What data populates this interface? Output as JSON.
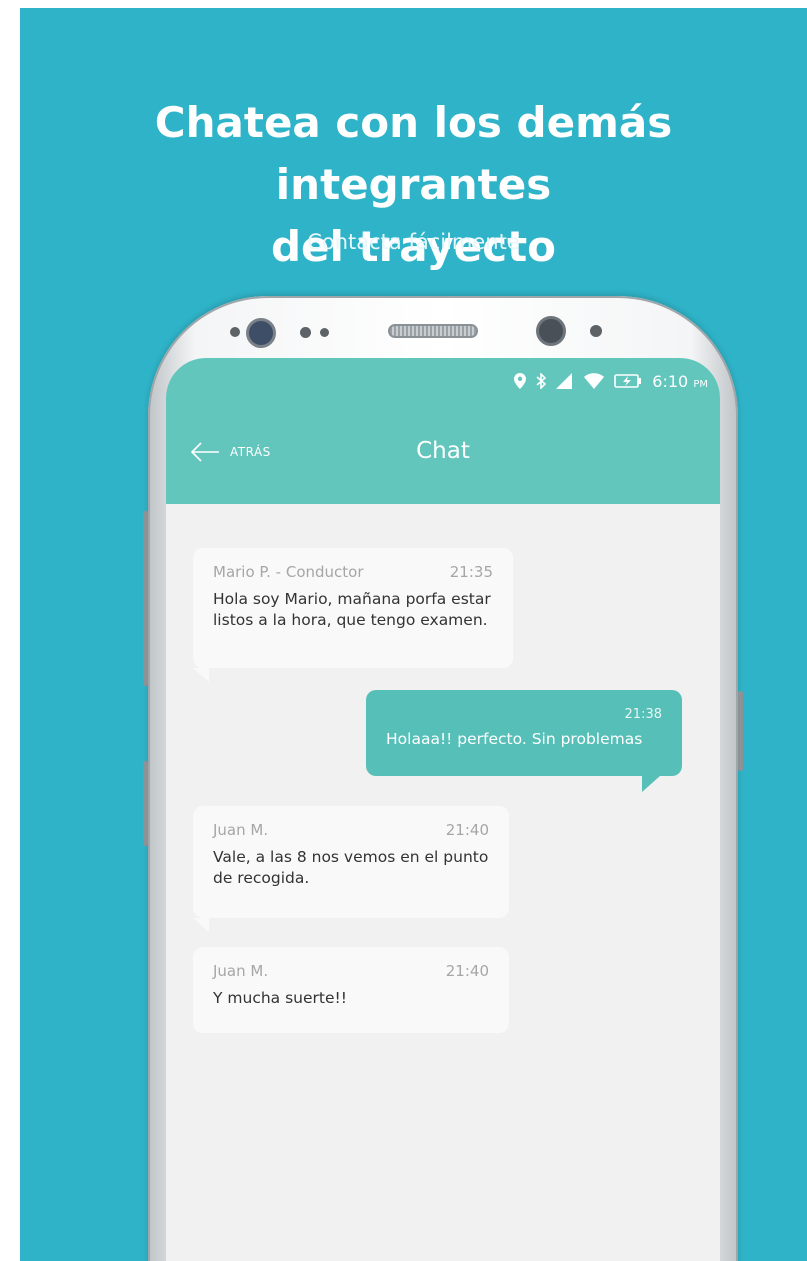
{
  "promo": {
    "headline_line1": "Chatea con los demás integrantes",
    "headline_line2": "del trayecto",
    "subheadline": "Contacta fácilmente",
    "background_color": "#2fb3c8"
  },
  "statusbar": {
    "icons": [
      "location-icon",
      "bluetooth-icon",
      "signal-icon",
      "wifi-icon",
      "battery-charging-icon"
    ],
    "time": "6:10",
    "ampm": "PM"
  },
  "appbar": {
    "back_label": "ATRÁS",
    "title": "Chat",
    "color": "#62c6bd"
  },
  "messages": [
    {
      "direction": "incoming",
      "sender": "Mario P. - Conductor",
      "time": "21:35",
      "text": "Hola soy Mario, mañana porfa estar listos a la hora, que tengo examen."
    },
    {
      "direction": "outgoing",
      "time": "21:38",
      "text": "Holaaa!! perfecto. Sin problemas"
    },
    {
      "direction": "incoming",
      "sender": "Juan M.",
      "time": "21:40",
      "text": "Vale, a las 8 nos vemos en el punto de recogida."
    },
    {
      "direction": "incoming",
      "sender": "Juan M.",
      "time": "21:40",
      "text": "Y mucha suerte!!"
    }
  ]
}
